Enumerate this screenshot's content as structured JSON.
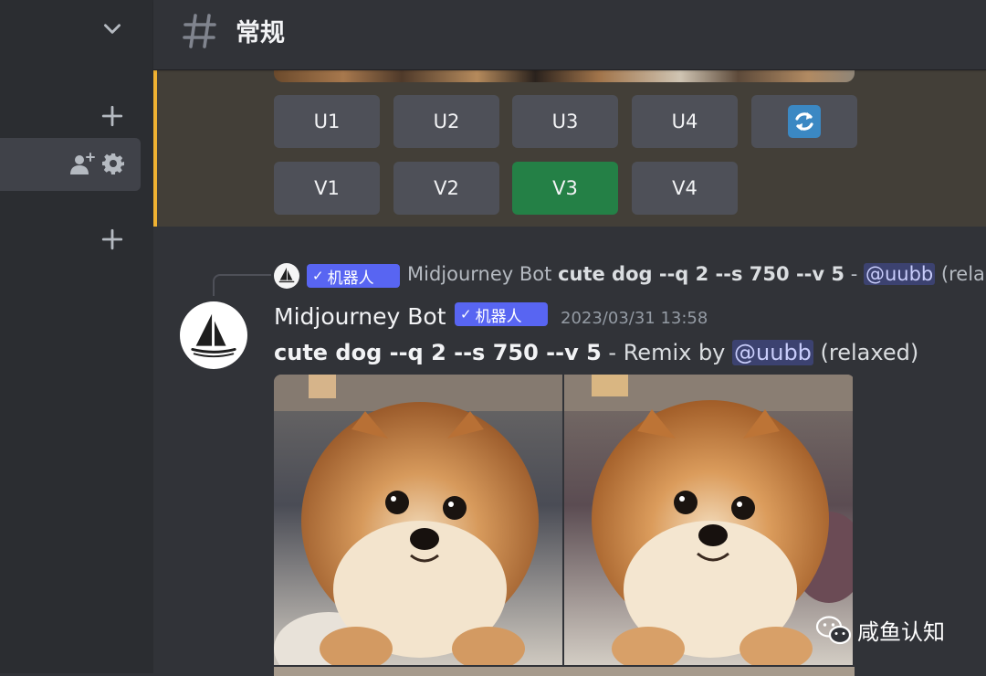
{
  "header": {
    "channel_name": "常规"
  },
  "sidebar": {
    "icons": [
      "chevron-down-icon",
      "plus-icon",
      "add-member-icon",
      "gear-icon",
      "plus-icon"
    ]
  },
  "top_message": {
    "buttons_row1": [
      "U1",
      "U2",
      "U3",
      "U4"
    ],
    "refresh_icon": "refresh-icon",
    "buttons_row2": [
      "V1",
      "V2",
      "V3",
      "V4"
    ],
    "selected_button": "V3"
  },
  "reply": {
    "tag": "机器人",
    "author": "Midjourney Bot",
    "prompt": "cute dog --q 2 --s 750 --v 5",
    "separator": "-",
    "mention": "@uubb",
    "suffix": "(rela"
  },
  "message": {
    "author": "Midjourney Bot",
    "tag": "机器人",
    "timestamp": "2023/03/31 13:58",
    "prompt": "cute dog --q 2 --s 750 --v 5",
    "remix_text": " - Remix by ",
    "mention": "@uubb",
    "suffix": " (relaxed)"
  },
  "watermark": {
    "text": "咸鱼认知"
  },
  "colors": {
    "accent": "#5865f2",
    "highlight": "#f0b232",
    "selected": "#248046"
  }
}
